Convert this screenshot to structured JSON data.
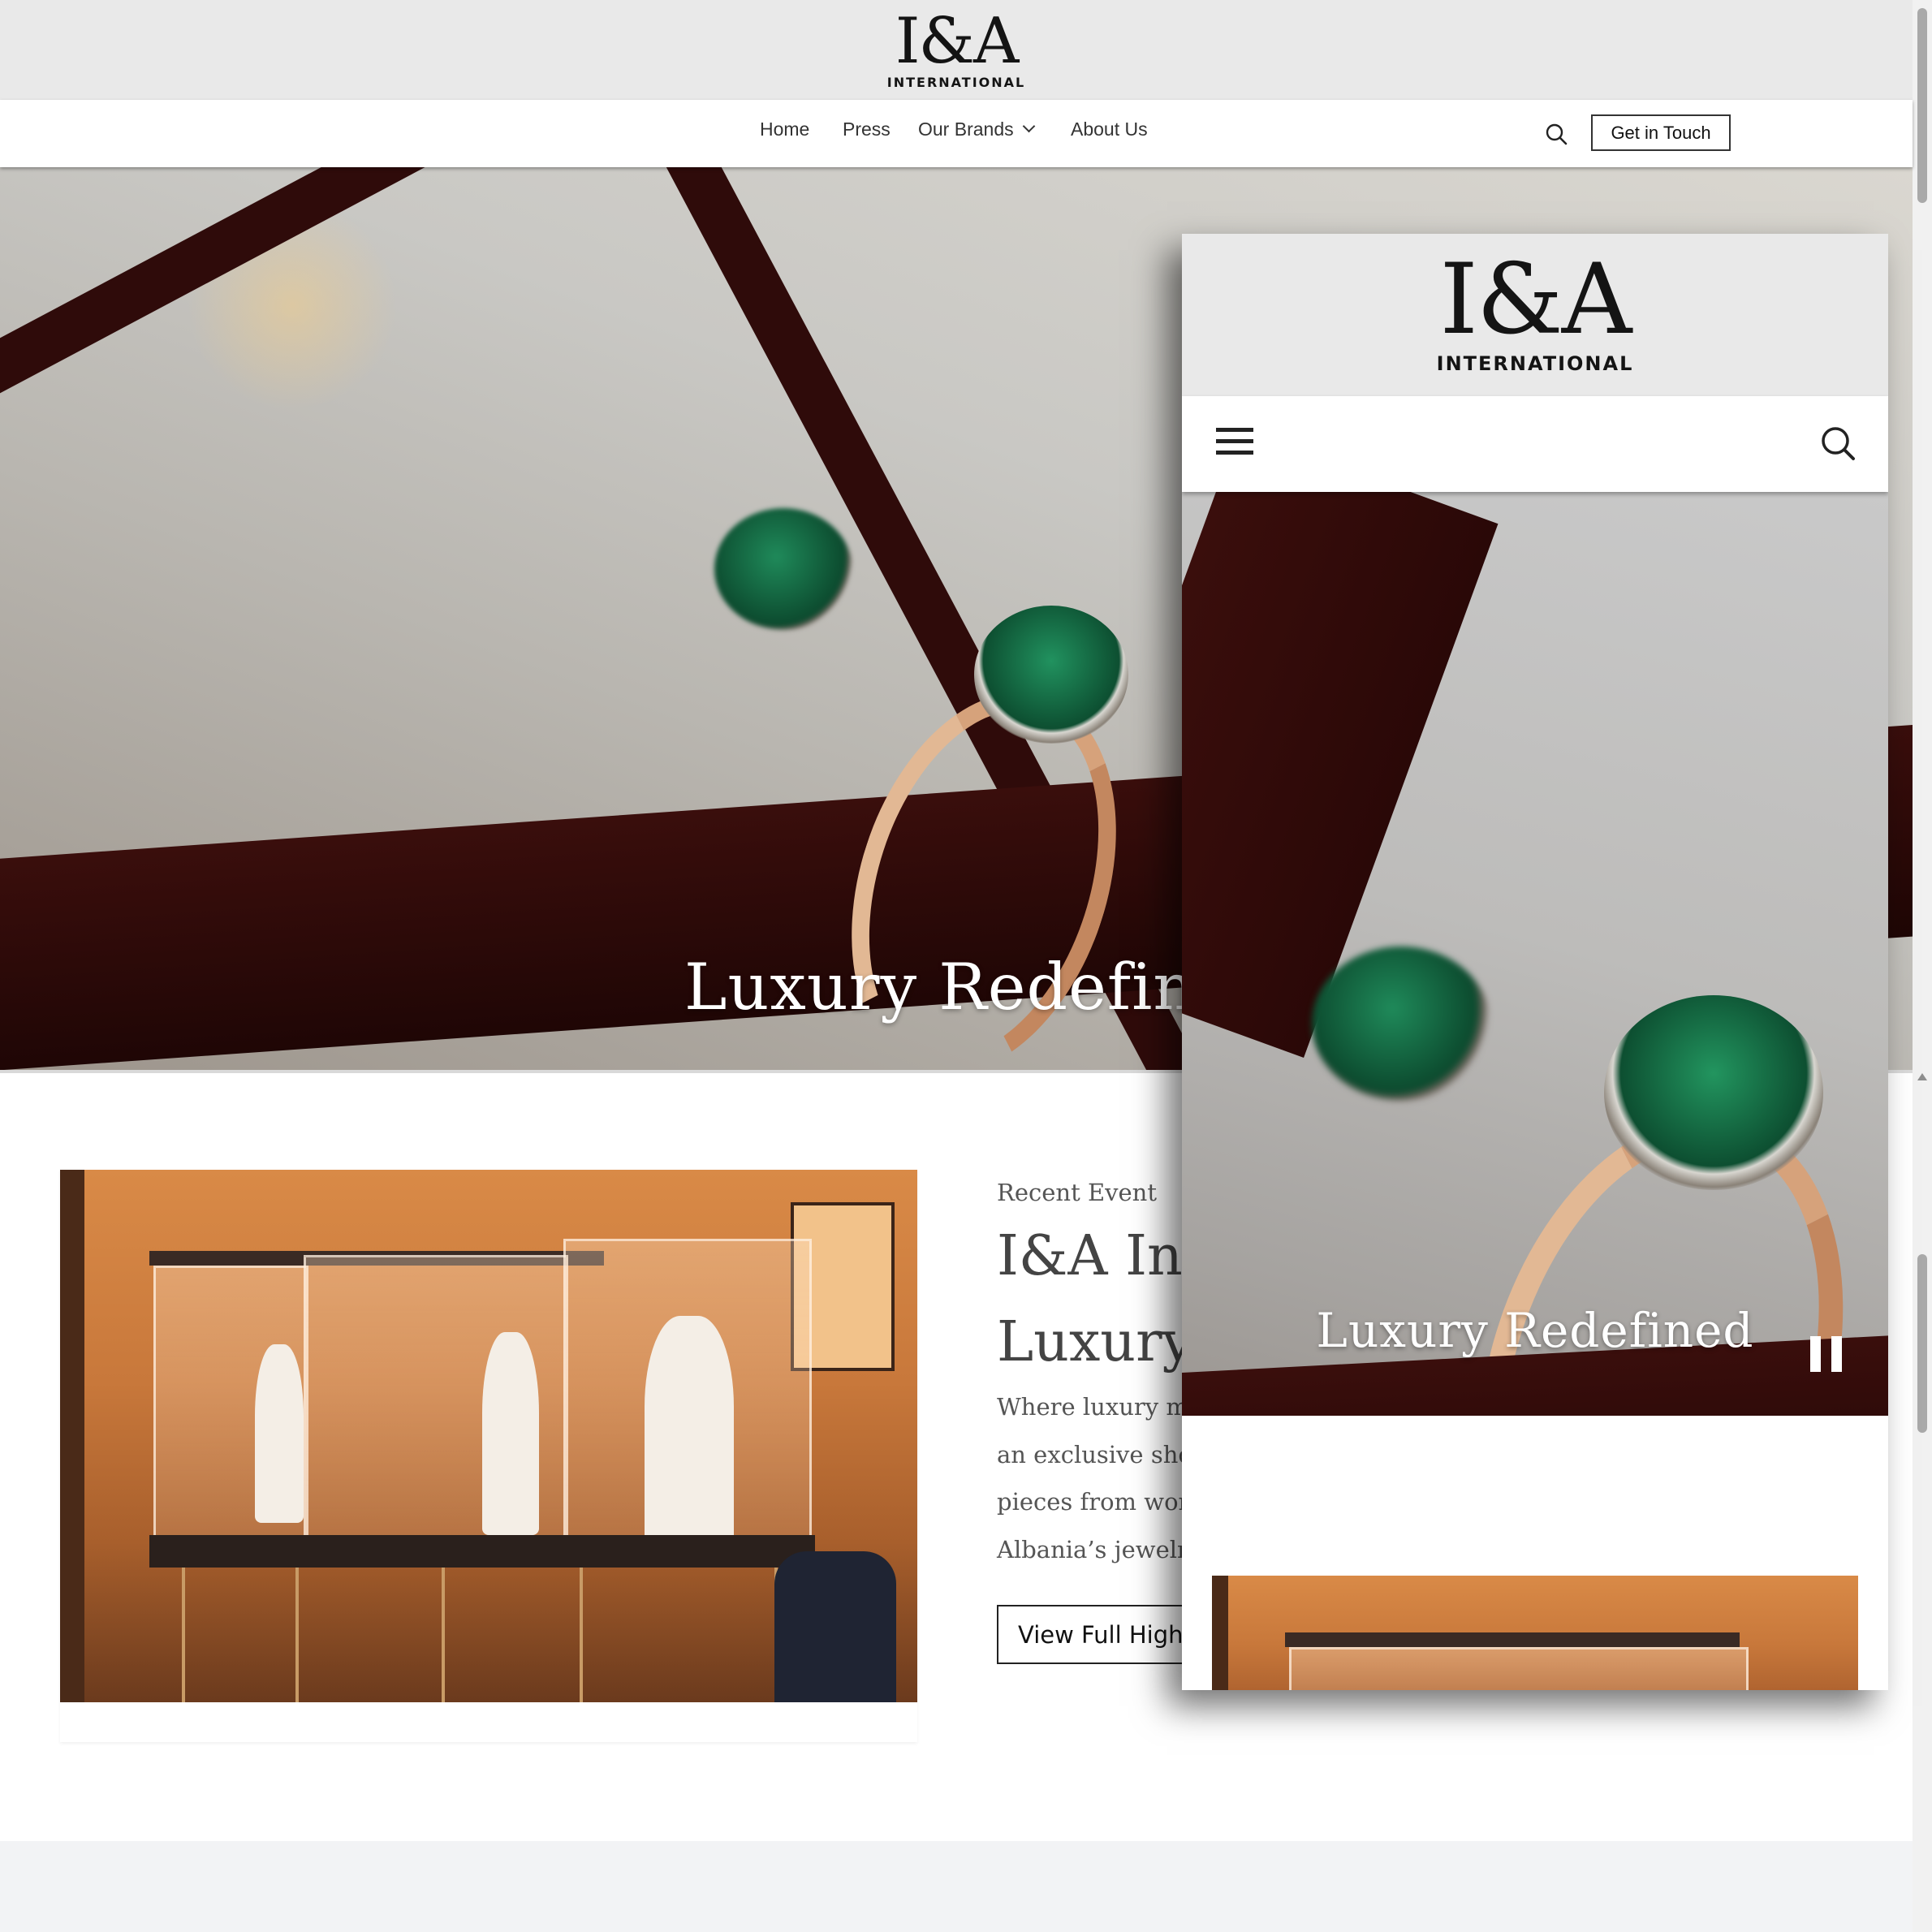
{
  "brand": {
    "name": "I&A",
    "subtitle": "INTERNATIONAL"
  },
  "nav": {
    "items": [
      {
        "label": "Home"
      },
      {
        "label": "Press"
      },
      {
        "label": "Our Brands",
        "has_dropdown": true
      },
      {
        "label": "About Us"
      }
    ],
    "cta_label": "Get in Touch",
    "search_icon": "search-icon"
  },
  "hero": {
    "title": "Luxury Redefine"
  },
  "event": {
    "kicker": "Recent Event",
    "title_lines": [
      "I&A Int",
      "Luxury"
    ],
    "body_lines": [
      "Where luxury me",
      "an exclusive sho",
      "pieces from worl",
      "Albania’s jewelry"
    ],
    "button_label": "View Full Highl"
  },
  "mobile": {
    "brand": {
      "name": "I&A",
      "subtitle": "INTERNATIONAL"
    },
    "hero_title": "Luxury Redefined",
    "menu_icon": "hamburger-menu-icon",
    "search_icon": "search-icon",
    "pause_icon": "pause-icon"
  },
  "colors": {
    "topbar": "#e9e9e9",
    "hero_overlay_text": "#ffffff",
    "body_text": "#555555",
    "bottom_band": "#f2f3f5"
  }
}
